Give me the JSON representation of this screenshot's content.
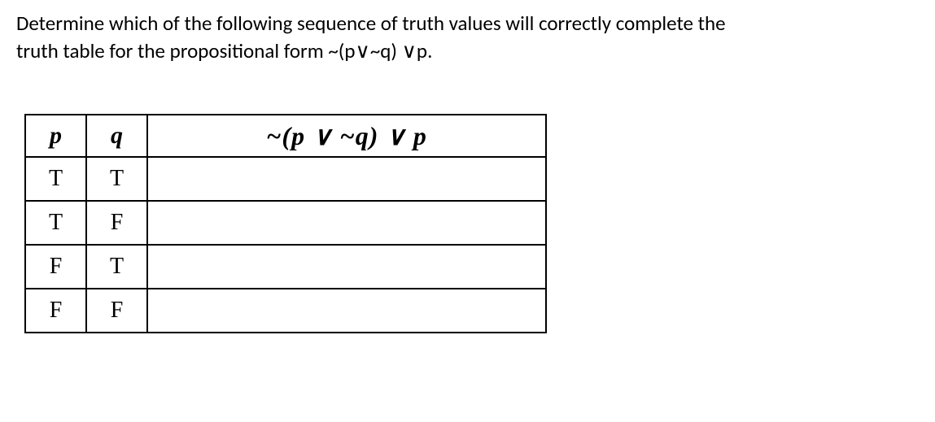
{
  "prompt": {
    "line1": "Determine which of the following sequence of truth values will correctly complete the",
    "line2": "truth table for the propositional form ~(p∨~q) ∨p."
  },
  "table": {
    "headers": {
      "p": "p",
      "q": "q",
      "formula": "~(p ∨ ~q) ∨ p"
    },
    "rows": [
      {
        "p": "T",
        "q": "T",
        "result": ""
      },
      {
        "p": "T",
        "q": "F",
        "result": ""
      },
      {
        "p": "F",
        "q": "T",
        "result": ""
      },
      {
        "p": "F",
        "q": "F",
        "result": ""
      }
    ]
  }
}
